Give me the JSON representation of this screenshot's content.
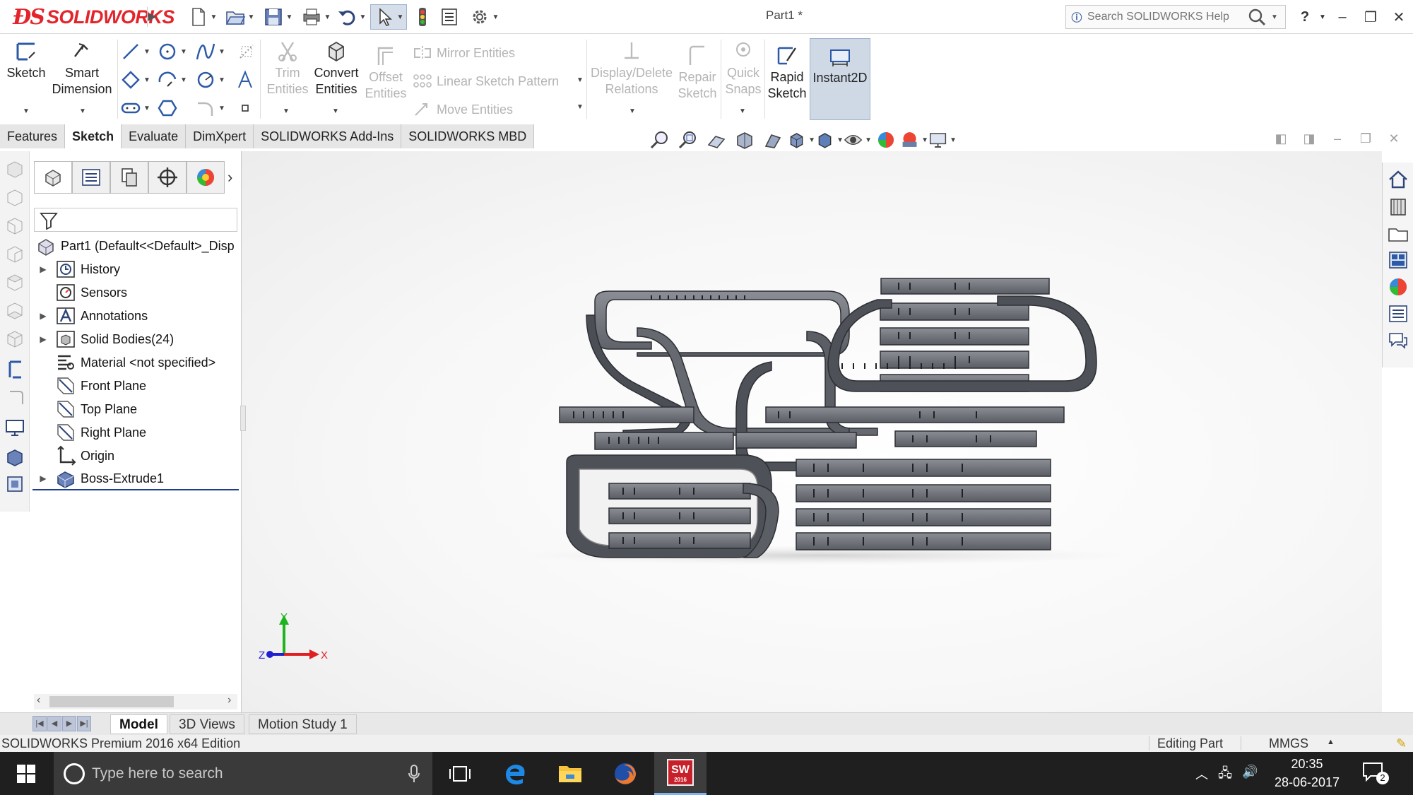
{
  "titlebar": {
    "brand": "SOLIDWORKS",
    "document_title": "Part1 *",
    "search_placeholder": "Search SOLIDWORKS Help",
    "help_label": "?"
  },
  "commands": {
    "sketch": "Sketch",
    "smart_dimension_1": "Smart",
    "smart_dimension_2": "Dimension",
    "trim_1": "Trim",
    "trim_2": "Entities",
    "convert_1": "Convert",
    "convert_2": "Entities",
    "offset_1": "Offset",
    "offset_2": "Entities",
    "mirror": "Mirror Entities",
    "linear_pattern": "Linear Sketch Pattern",
    "move": "Move Entities",
    "display_delete_1": "Display/Delete",
    "display_delete_2": "Relations",
    "repair_1": "Repair",
    "repair_2": "Sketch",
    "quick_snaps_1": "Quick",
    "quick_snaps_2": "Snaps",
    "rapid_1": "Rapid",
    "rapid_2": "Sketch",
    "instant2d": "Instant2D"
  },
  "tabs": [
    {
      "label": "Features"
    },
    {
      "label": "Sketch"
    },
    {
      "label": "Evaluate"
    },
    {
      "label": "DimXpert"
    },
    {
      "label": "SOLIDWORKS Add-Ins"
    },
    {
      "label": "SOLIDWORKS MBD"
    }
  ],
  "feature_tree": {
    "root": "Part1  (Default<<Default>_Disp",
    "items": [
      {
        "label": "History",
        "icon": "history-icon"
      },
      {
        "label": "Sensors",
        "icon": "sensor-icon"
      },
      {
        "label": "Annotations",
        "icon": "annotations-icon"
      },
      {
        "label": "Solid Bodies(24)",
        "icon": "solid-bodies-icon"
      },
      {
        "label": "Material <not specified>",
        "icon": "material-icon"
      },
      {
        "label": "Front Plane",
        "icon": "plane-icon"
      },
      {
        "label": "Top Plane",
        "icon": "plane-icon"
      },
      {
        "label": "Right Plane",
        "icon": "plane-icon"
      },
      {
        "label": "Origin",
        "icon": "origin-icon"
      },
      {
        "label": "Boss-Extrude1",
        "icon": "extrude-icon"
      }
    ]
  },
  "triad": {
    "x": "X",
    "y": "Y",
    "z": "Z"
  },
  "bottom_tabs": [
    {
      "label": "Model"
    },
    {
      "label": "3D Views"
    },
    {
      "label": "Motion Study 1"
    }
  ],
  "status": {
    "edition": "SOLIDWORKS Premium 2016 x64 Edition",
    "mode": "Editing Part",
    "units": "MMGS"
  },
  "taskbar": {
    "search_placeholder": "Type here to search",
    "time": "20:35",
    "date": "28-06-2017",
    "notifications": "2",
    "sw_badge": "SW",
    "sw_year": "2016"
  },
  "colors": {
    "brand_red": "#e4242b",
    "model_body": "#6e7178",
    "model_dark": "#3e4047",
    "selection_line": "#1e3c8c"
  }
}
